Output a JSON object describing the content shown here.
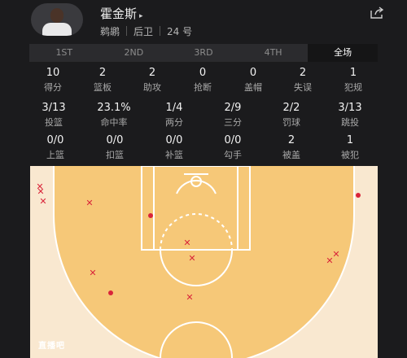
{
  "player": {
    "name": "霍金斯",
    "arrow": "▸",
    "team": "鹈鹕",
    "position": "后卫",
    "number": "24 号"
  },
  "tabs": [
    "1ST",
    "2ND",
    "3RD",
    "4TH",
    "全场"
  ],
  "active_tab": "全场",
  "stats_row1": [
    {
      "value": "10",
      "label": "得分"
    },
    {
      "value": "2",
      "label": "篮板"
    },
    {
      "value": "2",
      "label": "助攻"
    },
    {
      "value": "0",
      "label": "抢断"
    },
    {
      "value": "0",
      "label": "盖帽"
    },
    {
      "value": "2",
      "label": "失误"
    },
    {
      "value": "1",
      "label": "犯规"
    }
  ],
  "stats_row2": [
    {
      "value": "3/13",
      "label": "投篮"
    },
    {
      "value": "23.1%",
      "label": "命中率"
    },
    {
      "value": "1/4",
      "label": "两分"
    },
    {
      "value": "2/9",
      "label": "三分"
    },
    {
      "value": "2/2",
      "label": "罚球"
    },
    {
      "value": "3/13",
      "label": "跳投"
    }
  ],
  "stats_row3": [
    {
      "value": "0/0",
      "label": "上篮"
    },
    {
      "value": "0/0",
      "label": "扣篮"
    },
    {
      "value": "0/0",
      "label": "补篮"
    },
    {
      "value": "0/0",
      "label": "勾手"
    },
    {
      "value": "2",
      "label": "被盖"
    },
    {
      "value": "1",
      "label": "被犯"
    }
  ],
  "shot_chart": {
    "made_color": "#d9243a",
    "court_color": "#f9e8d0",
    "paint_color": "#f6c878",
    "missed_mark": "✕",
    "made_mark": "●"
  },
  "watermark": "直播吧",
  "colors": {
    "background": "#1b1b1d",
    "tab_bg": "#2b2b2e",
    "accent_red": "#d9243a"
  }
}
